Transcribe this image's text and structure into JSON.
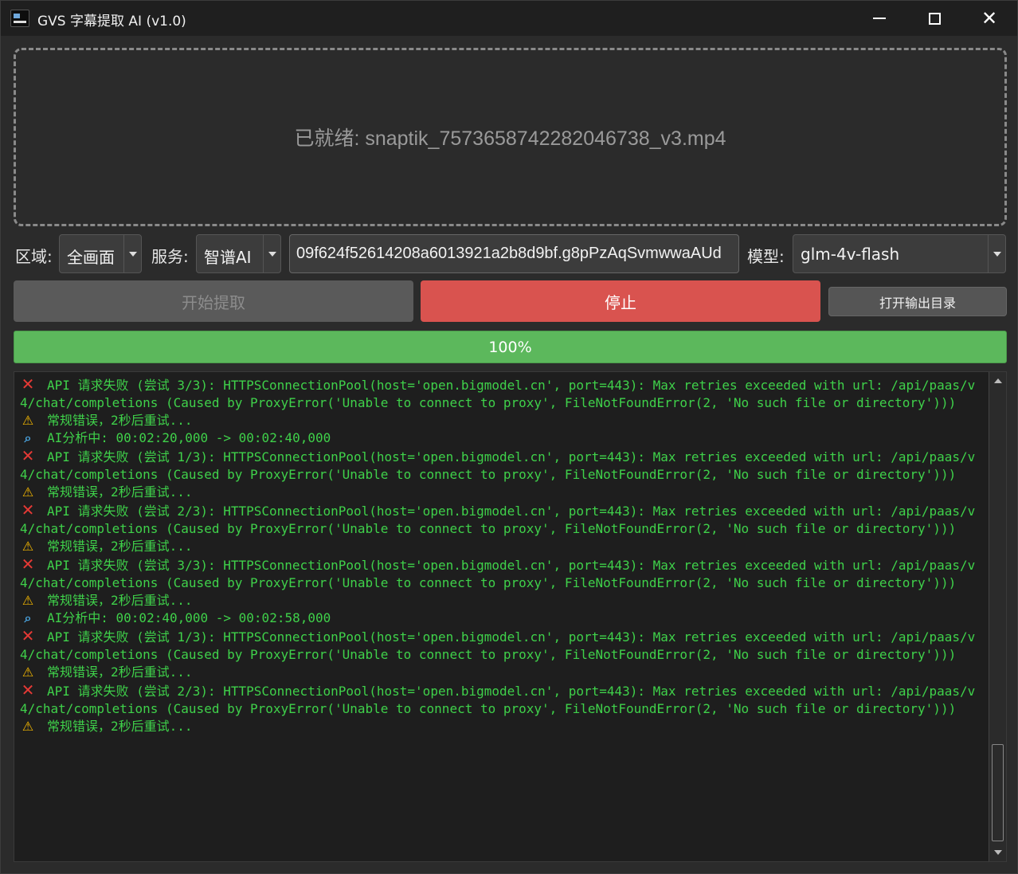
{
  "window": {
    "title": "GVS 字幕提取 AI (v1.0)"
  },
  "dropzone": {
    "status": "已就绪: snaptik_7573658742282046738_v3.mp4"
  },
  "controls": {
    "region_label": "区域:",
    "region_value": "全画面",
    "service_label": "服务:",
    "service_value": "智谱AI",
    "api_key_value": "09f624f52614208a6013921a2b8d9bf.g8pPzAqSvmwwaAUd",
    "model_label": "模型:",
    "model_value": "glm-4v-flash"
  },
  "buttons": {
    "start": "开始提取",
    "stop": "停止",
    "open_output": "打开输出目录"
  },
  "progress": {
    "text": "100%",
    "value": 1.0
  },
  "log": {
    "lines": [
      {
        "icon": "x",
        "text": "API 请求失败 (尝试 3/3): HTTPSConnectionPool(host='open.bigmodel.cn', port=443): Max retries exceeded with url: /api/paas/v4/chat/completions (Caused by ProxyError('Unable to connect to proxy', FileNotFoundError(2, 'No such file or directory')))"
      },
      {
        "icon": "warn",
        "text": "常规错误，2秒后重试..."
      },
      {
        "icon": "search",
        "text": "AI分析中: 00:02:20,000 -> 00:02:40,000"
      },
      {
        "icon": "x",
        "text": "API 请求失败 (尝试 1/3): HTTPSConnectionPool(host='open.bigmodel.cn', port=443): Max retries exceeded with url: /api/paas/v4/chat/completions (Caused by ProxyError('Unable to connect to proxy', FileNotFoundError(2, 'No such file or directory')))"
      },
      {
        "icon": "warn",
        "text": "常规错误，2秒后重试..."
      },
      {
        "icon": "x",
        "text": "API 请求失败 (尝试 2/3): HTTPSConnectionPool(host='open.bigmodel.cn', port=443): Max retries exceeded with url: /api/paas/v4/chat/completions (Caused by ProxyError('Unable to connect to proxy', FileNotFoundError(2, 'No such file or directory')))"
      },
      {
        "icon": "warn",
        "text": "常规错误，2秒后重试..."
      },
      {
        "icon": "x",
        "text": "API 请求失败 (尝试 3/3): HTTPSConnectionPool(host='open.bigmodel.cn', port=443): Max retries exceeded with url: /api/paas/v4/chat/completions (Caused by ProxyError('Unable to connect to proxy', FileNotFoundError(2, 'No such file or directory')))"
      },
      {
        "icon": "warn",
        "text": "常规错误，2秒后重试..."
      },
      {
        "icon": "search",
        "text": "AI分析中: 00:02:40,000 -> 00:02:58,000"
      },
      {
        "icon": "x",
        "text": "API 请求失败 (尝试 1/3): HTTPSConnectionPool(host='open.bigmodel.cn', port=443): Max retries exceeded with url: /api/paas/v4/chat/completions (Caused by ProxyError('Unable to connect to proxy', FileNotFoundError(2, 'No such file or directory')))"
      },
      {
        "icon": "warn",
        "text": "常规错误，2秒后重试..."
      },
      {
        "icon": "x",
        "text": "API 请求失败 (尝试 2/3): HTTPSConnectionPool(host='open.bigmodel.cn', port=443): Max retries exceeded with url: /api/paas/v4/chat/completions (Caused by ProxyError('Unable to connect to proxy', FileNotFoundError(2, 'No such file or directory')))"
      },
      {
        "icon": "warn",
        "text": "常规错误，2秒后重试..."
      }
    ]
  },
  "icons": {
    "x": "red-cross-icon",
    "warn": "warning-icon",
    "search": "magnifier-icon"
  },
  "colors": {
    "log_text": "#3fd14a",
    "stop_button": "#d9534f",
    "progress_fill": "#5cb85c"
  }
}
